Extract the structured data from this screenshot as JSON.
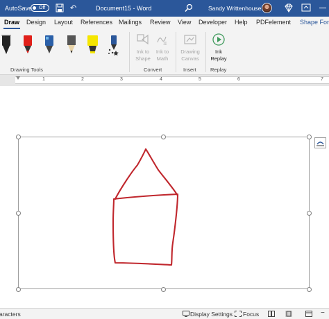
{
  "titlebar": {
    "autosave_label": "AutoSave",
    "autosave_state": "Off",
    "document_title": "Document15 - Word",
    "user_name": "Sandy Writtenhouse",
    "icons": [
      "save-icon",
      "undo-icon",
      "search-icon",
      "avatar",
      "diamond-icon",
      "ribbon-display-options-icon"
    ]
  },
  "tabs": {
    "items": [
      "Draw",
      "Design",
      "Layout",
      "References",
      "Mailings",
      "Review",
      "View",
      "Developer",
      "Help",
      "PDFelement",
      "Shape Form"
    ],
    "active": "Draw"
  },
  "ribbon": {
    "drawing_tools": {
      "label": "Drawing Tools",
      "pens": [
        {
          "name": "black-pen",
          "color": "#1a1a1a"
        },
        {
          "name": "red-pen",
          "color": "#e0201a"
        },
        {
          "name": "galaxy-pen",
          "color": "#2a5fa8"
        },
        {
          "name": "pencil",
          "color": "#555555"
        },
        {
          "name": "highlighter",
          "color": "#f5e600"
        },
        {
          "name": "action-pen",
          "color": "#2b579a"
        }
      ]
    },
    "convert": {
      "label": "Convert",
      "ink_to_shape": [
        "Ink to",
        "Shape"
      ],
      "ink_to_math": [
        "Ink to",
        "Math"
      ]
    },
    "insert": {
      "label": "Insert",
      "drawing_canvas": [
        "Drawing",
        "Canvas"
      ]
    },
    "replay": {
      "label": "Replay",
      "ink_replay": [
        "Ink",
        "Replay"
      ]
    }
  },
  "ruler": {
    "numbers": [
      "1",
      "2",
      "3",
      "4",
      "5",
      "6",
      "7"
    ]
  },
  "document": {
    "ink_color": "#c0272d"
  },
  "statusbar": {
    "characters": "aracters",
    "display_settings": "Display Settings",
    "focus": "Focus"
  },
  "colors": {
    "title_bar": "#2b579a",
    "ribbon_bg": "#f3f3f3",
    "accent": "#2b579a"
  }
}
